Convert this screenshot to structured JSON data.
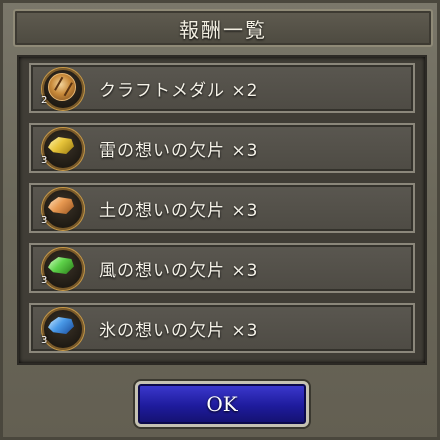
{
  "dialog": {
    "title": "報酬一覧"
  },
  "rewards": [
    {
      "label": "クラフトメダル ×2",
      "icon": "craft-medal-icon",
      "icon_qty": "2",
      "color": "#d29a4a"
    },
    {
      "label": "雷の想いの欠片 ×3",
      "icon": "thunder-shard-icon",
      "icon_qty": "3",
      "color": "#e7c43a"
    },
    {
      "label": "土の想いの欠片 ×3",
      "icon": "earth-shard-icon",
      "icon_qty": "3",
      "color": "#e89a52"
    },
    {
      "label": "風の想いの欠片 ×3",
      "icon": "wind-shard-icon",
      "icon_qty": "3",
      "color": "#5ed24a"
    },
    {
      "label": "氷の想いの欠片 ×3",
      "icon": "ice-shard-icon",
      "icon_qty": "3",
      "color": "#4a9ae8"
    }
  ],
  "ok_button": {
    "label": "OK"
  }
}
